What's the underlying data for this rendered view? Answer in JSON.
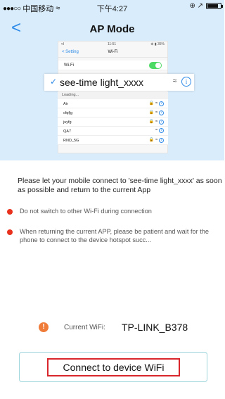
{
  "status_bar": {
    "signal_dots": "●●●○○",
    "carrier": "中国移动",
    "wifi_symbol": "≈",
    "time": "下午4:27",
    "right_icons": "⊕ ↗"
  },
  "nav": {
    "back_glyph": "<",
    "title": "AP Mode"
  },
  "illustration": {
    "mock_status_left": "•ıl",
    "mock_status_time": "11:51",
    "mock_status_right": "⊕ ▮ 35%",
    "back_label": "< Setting",
    "screen_title": "Wi-Fi",
    "wifi_label": "Wi-Fi",
    "wifi_enabled": true,
    "selected_ssid": "see-time light_xxxx",
    "check_glyph": "✓",
    "loading_label": "Loading...",
    "networks": [
      {
        "name": "Air",
        "icons": "🔒 ≈"
      },
      {
        "name": "cfqfjg",
        "icons": "🔒 ≈"
      },
      {
        "name": "juyfg",
        "icons": "🔒 ≈"
      },
      {
        "name": "QA7",
        "icons": "≈"
      },
      {
        "name": "RND_5G",
        "icons": "🔒 ≈"
      }
    ],
    "info_glyph": "i",
    "signal_glyph": "≈"
  },
  "instructions": {
    "main_message": "Please let your mobile connect to 'see-time light_xxxx' as soon as possible and return to the current App",
    "bullets": [
      "Do not switch to other Wi-Fi during connection",
      "When returning the current APP, please be patient and wait for the phone to connect to the device hotspot succ..."
    ]
  },
  "current_wifi": {
    "warning_glyph": "!",
    "label": "Current WiFi:",
    "value": "TP-LINK_B378"
  },
  "actions": {
    "connect_label": "Connect to device WiFi"
  },
  "colors": {
    "accent_blue": "#2c8ae8",
    "top_background": "#d9ecfb",
    "bullet_red": "#e8321e",
    "warning_orange": "#f07c3a",
    "button_highlight_red": "#d9262c",
    "button_border_teal": "#9fd6dd"
  }
}
